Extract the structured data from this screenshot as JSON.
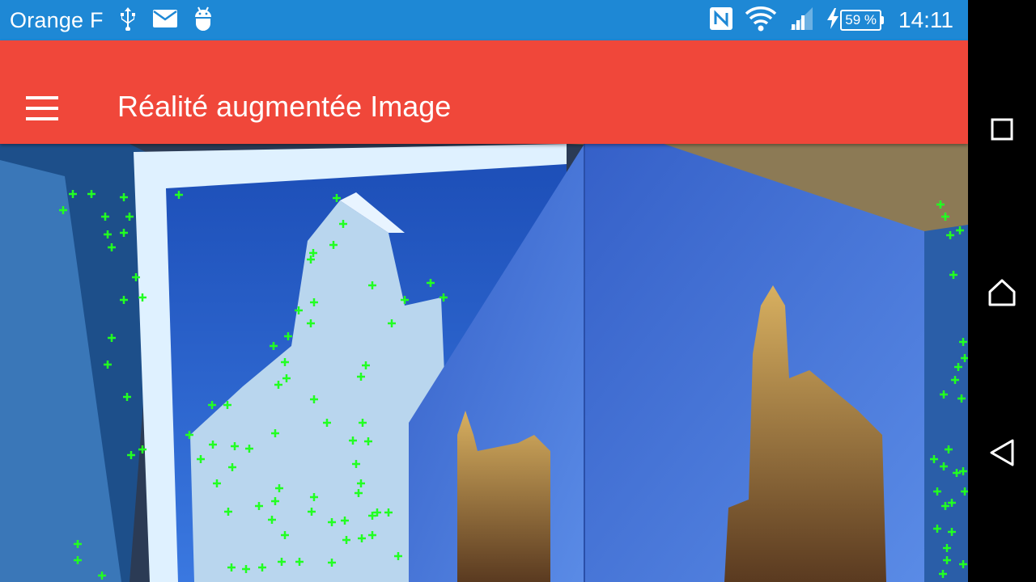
{
  "status_bar": {
    "carrier": "Orange F",
    "icons_left": [
      "usb-icon",
      "mail-icon",
      "android-debug-icon"
    ],
    "icons_right": [
      "nfc-icon",
      "wifi-icon",
      "signal-icon",
      "charging-icon"
    ],
    "battery_level": 59,
    "battery": "59 %",
    "time": "14:11",
    "color": "#1e88d5"
  },
  "app_bar": {
    "title": "Réalité augmentée Image",
    "menu_icon": "hamburger-menu-icon",
    "color": "#f0473a"
  },
  "nav_bar": {
    "buttons": [
      "recent-apps-button",
      "home-button",
      "back-button"
    ]
  },
  "colors": {
    "feature_marker": "#22ff22"
  }
}
